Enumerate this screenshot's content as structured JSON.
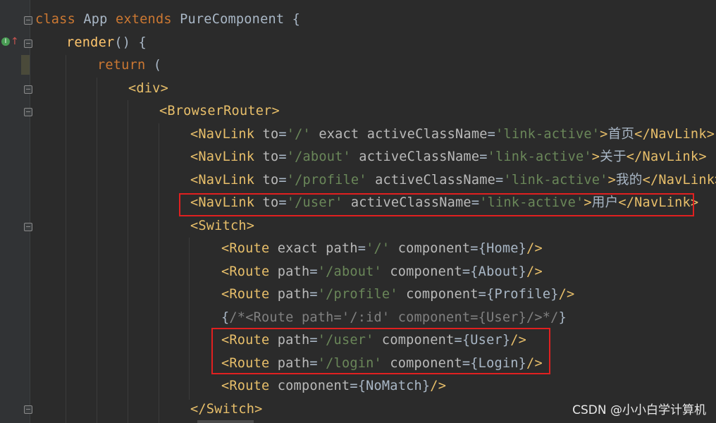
{
  "lines": [
    [
      "class",
      " App ",
      "extends",
      " PureComponent {"
    ],
    [
      "render",
      "() {"
    ],
    [
      "return",
      " ("
    ],
    [
      "<div>"
    ],
    [
      "<BrowserRouter>"
    ],
    [
      "<NavLink",
      " to",
      "=",
      "'/'",
      " exact",
      " activeClassName",
      "=",
      "'link-active'",
      ">",
      "首页",
      "</NavLink>"
    ],
    [
      "<NavLink",
      " to",
      "=",
      "'/about'",
      " activeClassName",
      "=",
      "'link-active'",
      ">",
      "关于",
      "</NavLink>"
    ],
    [
      "<NavLink",
      " to",
      "=",
      "'/profile'",
      " activeClassName",
      "=",
      "'link-active'",
      ">",
      "我的",
      "</NavLink>"
    ],
    [
      "<NavLink",
      " to",
      "=",
      "'/user'",
      " activeClassName",
      "=",
      "'link-active'",
      ">",
      "用户",
      "</NavLink>"
    ],
    [
      "<Switch>"
    ],
    [
      "<Route",
      " exact",
      " path",
      "=",
      "'/'",
      " component",
      "=",
      "{Home}",
      "/>"
    ],
    [
      "<Route",
      " path",
      "=",
      "'/about'",
      " component",
      "=",
      "{About}",
      "/>"
    ],
    [
      "<Route",
      " path",
      "=",
      "'/profile'",
      " component",
      "=",
      "{Profile}",
      "/>"
    ],
    [
      "{",
      "/*<Route path='/:id' component={User}/>*/",
      "}"
    ],
    [
      "<Route",
      " path",
      "=",
      "'/user'",
      " component",
      "=",
      "{User}",
      "/>"
    ],
    [
      "<Route",
      " path",
      "=",
      "'/login'",
      " component",
      "=",
      "{Login}",
      "/>"
    ],
    [
      "<Route",
      " component",
      "=",
      "{NoMatch}",
      "/>"
    ],
    [
      "</Switch>"
    ]
  ],
  "watermark": "CSDN @小小白学计算机",
  "gutter": {
    "override_icon": "override-method-icon",
    "fold_icon": "fold-marker-icon"
  },
  "colors": {
    "background": "#2b2b2b",
    "keyword": "#cc7832",
    "tag": "#e8bf6a",
    "string": "#6a8759",
    "highlight_box": "#e02020"
  }
}
